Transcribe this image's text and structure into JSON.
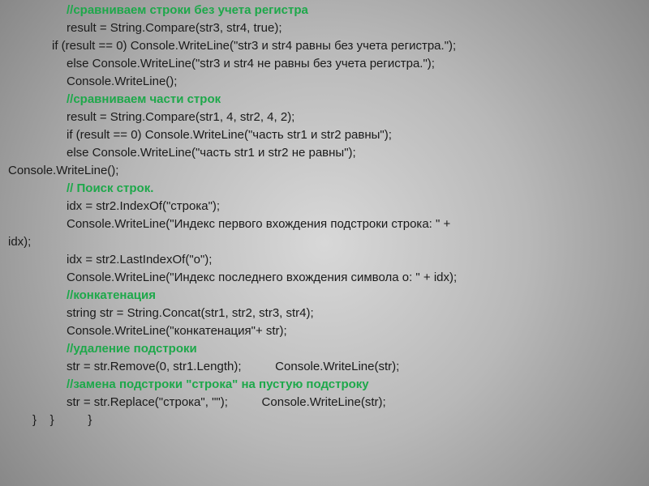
{
  "lines": [
    {
      "kind": "comment",
      "indent": "indent1",
      "text": "//сравниваем строки без учета регистра"
    },
    {
      "kind": "code",
      "indent": "indent1",
      "text": "result = String.Compare(str3, str4, true);"
    },
    {
      "kind": "code",
      "indent": "indent0a",
      "text": "if (result == 0) Console.WriteLine(\"str3 и str4 равны без учета регистра.\");"
    },
    {
      "kind": "code",
      "indent": "indent1",
      "text": "else Console.WriteLine(\"str3 и str4 не равны без учета регистра.\");"
    },
    {
      "kind": "code",
      "indent": "indent1",
      "text": "Console.WriteLine();"
    },
    {
      "kind": "comment",
      "indent": "indent1",
      "text": "//сравниваем части строк"
    },
    {
      "kind": "code",
      "indent": "indent1",
      "text": "result = String.Compare(str1, 4, str2, 4, 2);"
    },
    {
      "kind": "code",
      "indent": "indent1",
      "text": "if (result == 0) Console.WriteLine(\"часть str1 и str2 равны\");"
    },
    {
      "kind": "code",
      "indent": "indent1",
      "text": "else Console.WriteLine(\"часть str1 и str2 не равны\");"
    },
    {
      "kind": "code",
      "indent": "noindent",
      "text": "Console.WriteLine();"
    },
    {
      "kind": "comment",
      "indent": "indent1",
      "text": "// Поиск строк."
    },
    {
      "kind": "code",
      "indent": "indent1",
      "text": "idx = str2.IndexOf(\"строка\");"
    },
    {
      "kind": "code",
      "indent": "indent1",
      "text": "Console.WriteLine(\"Индекс первого вхождения подстроки строка: \" +"
    },
    {
      "kind": "code",
      "indent": "noindent",
      "text": "idx);"
    },
    {
      "kind": "code",
      "indent": "indent1",
      "text": "idx = str2.LastIndexOf(\"o\");"
    },
    {
      "kind": "code",
      "indent": "indent1",
      "text": "Console.WriteLine(\"Индекс последнего вхождения символа о: \" + idx);"
    },
    {
      "kind": "comment",
      "indent": "indent1",
      "text": "//конкатенация"
    },
    {
      "kind": "code",
      "indent": "indent1",
      "text": "string str = String.Concat(str1, str2, str3, str4);"
    },
    {
      "kind": "code",
      "indent": "indent1",
      "text": "Console.WriteLine(\"конкатенация\"+ str);"
    },
    {
      "kind": "comment",
      "indent": "indent1",
      "text": "//удаление подстроки"
    },
    {
      "kind": "code",
      "indent": "indent1",
      "text": "str = str.Remove(0, str1.Length);          Console.WriteLine(str);"
    },
    {
      "kind": "comment",
      "indent": "indent1",
      "text": "//замена подстроки \"строка\" на пустую подстроку"
    },
    {
      "kind": "code",
      "indent": "indent1",
      "text": "str = str.Replace(\"строка\", \"\");          Console.WriteLine(str);"
    },
    {
      "kind": "code",
      "indent": "indent0",
      "text": "}    }          }"
    }
  ]
}
